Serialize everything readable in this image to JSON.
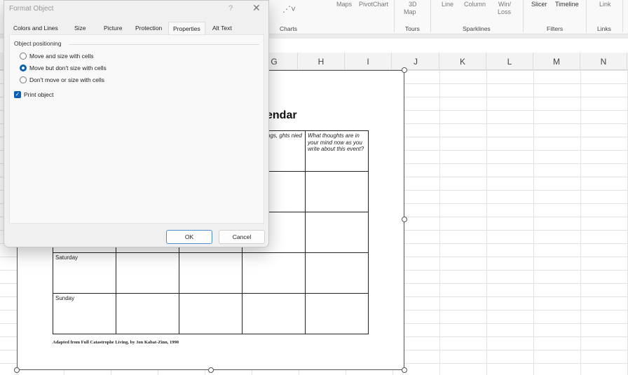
{
  "ribbon": {
    "buttons": [
      "Maps",
      "PivotChart",
      "3D",
      "Map",
      "Line",
      "Column",
      "Win/",
      "Loss",
      "Slicer",
      "Timeline",
      "Link"
    ],
    "groups": [
      "Charts",
      "Tours",
      "Sparklines",
      "Filters",
      "Links"
    ]
  },
  "columns": [
    "G",
    "H",
    "I",
    "J",
    "K",
    "L",
    "M",
    "N"
  ],
  "document": {
    "title_partial": "endar",
    "header_col4_partial": "ods, feelings, ghts nied the",
    "header_col5": "What thoughts are in your mind now as you write about this event?",
    "rows": [
      "Saturday",
      "Sunday"
    ],
    "credit": "Adapted from Full Catastrophe Living, by Jon Kabat-Zinn, 1990"
  },
  "dialog": {
    "title": "Format Object",
    "help": "?",
    "close": "✕",
    "tabs": [
      "Colors and Lines",
      "Size",
      "Picture",
      "Protection",
      "Properties",
      "Alt Text"
    ],
    "active_tab": "Properties",
    "group_label": "Object positioning",
    "options": [
      "Move and size with cells",
      "Move but don't size with cells",
      "Don't move or size with cells"
    ],
    "selected_option": "Move but don't size with cells",
    "print_object_label": "Print object",
    "print_object_checked": true,
    "ok": "OK",
    "cancel": "Cancel"
  },
  "colors": {
    "accent": "#0a5fb4"
  }
}
